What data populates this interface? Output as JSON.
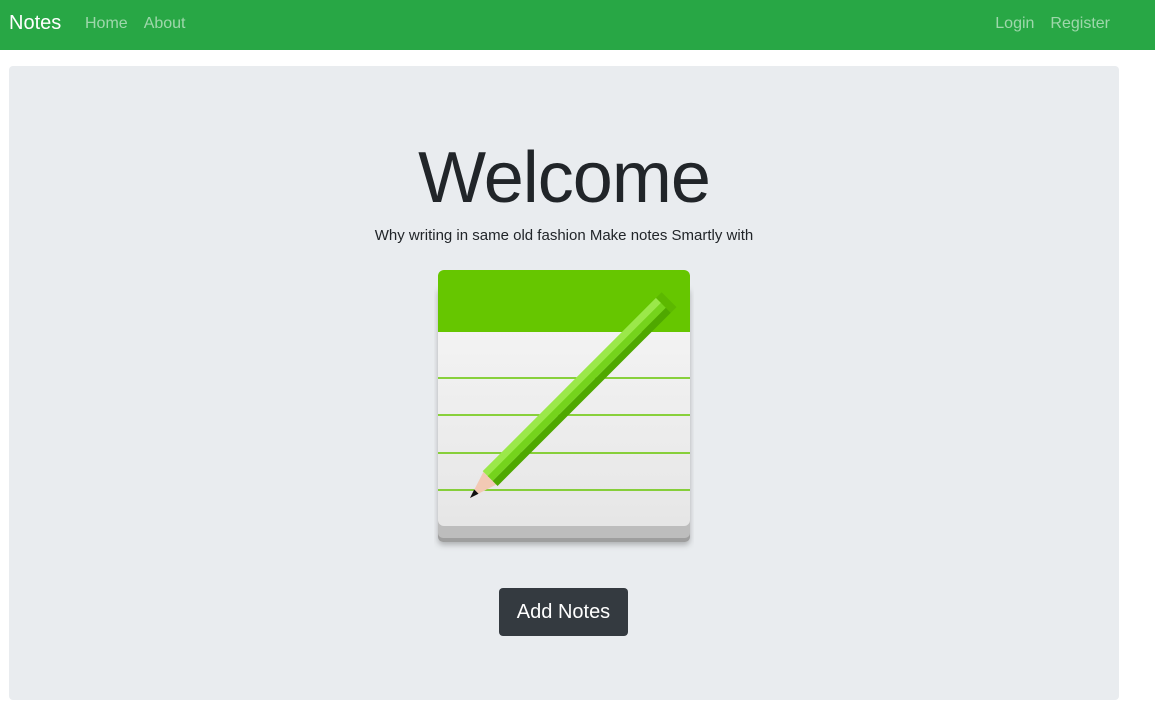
{
  "navbar": {
    "brand": "Notes",
    "left_links": [
      {
        "label": "Home"
      },
      {
        "label": "About"
      }
    ],
    "right_links": [
      {
        "label": "Login"
      },
      {
        "label": "Register"
      }
    ],
    "colors": {
      "background": "#28a745",
      "brand": "#ffffff",
      "link": "rgba(255,255,255,0.55)"
    }
  },
  "hero": {
    "title": "Welcome",
    "subtitle": "Why writing in same old fashion Make notes Smartly with",
    "logo_icon": "notepad-pencil-icon",
    "button_label": "Add Notes",
    "colors": {
      "background": "#e9ecef",
      "button": "#343a40",
      "logo_green": "#66c600"
    }
  }
}
